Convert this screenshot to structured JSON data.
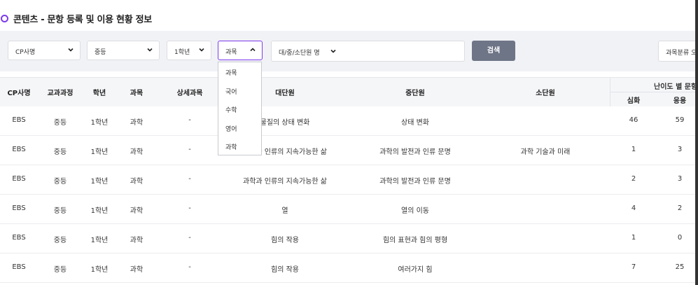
{
  "page": {
    "title": "콘텐츠 - 문항 등록 및 이용 현황 정보"
  },
  "filters": {
    "cp": "CP사명",
    "course": "중등",
    "grade": "1학년",
    "subject": "과목",
    "keyword_placeholder": "대/중/소단원 명",
    "search_label": "검색",
    "category_label": "과목분류 오"
  },
  "subject_options": [
    "과목",
    "국어",
    "수학",
    "영어",
    "과학"
  ],
  "table": {
    "headers": {
      "cp": "CP사명",
      "course": "교과과정",
      "grade": "학년",
      "subject": "과목",
      "detail": "상세과목",
      "large": "대단원",
      "mid": "중단원",
      "small": "소단원",
      "difficulty_group": "난이도 별 문항",
      "deep": "심화",
      "apply": "응용"
    },
    "rows": [
      {
        "cp": "EBS",
        "course": "중등",
        "grade": "1학년",
        "subject": "과학",
        "detail": "-",
        "large": "물질의 상태 변화",
        "mid": "상태 변화",
        "small": "",
        "deep": "46",
        "apply": "59"
      },
      {
        "cp": "EBS",
        "course": "중등",
        "grade": "1학년",
        "subject": "과학",
        "detail": "-",
        "large": "과학과 인류의 지속가능한 삶",
        "mid": "과학의 발전과 인류 문명",
        "small": "과학 기술과 미래",
        "deep": "1",
        "apply": "3"
      },
      {
        "cp": "EBS",
        "course": "중등",
        "grade": "1학년",
        "subject": "과학",
        "detail": "-",
        "large": "과학과 인류의 지속가능한 삶",
        "mid": "과학의 발전과 인류 문명",
        "small": "",
        "deep": "2",
        "apply": "3"
      },
      {
        "cp": "EBS",
        "course": "중등",
        "grade": "1학년",
        "subject": "과학",
        "detail": "-",
        "large": "열",
        "mid": "열의 이동",
        "small": "",
        "deep": "4",
        "apply": "2"
      },
      {
        "cp": "EBS",
        "course": "중등",
        "grade": "1학년",
        "subject": "과학",
        "detail": "-",
        "large": "힘의 작용",
        "mid": "힘의 표현과 힘의 평형",
        "small": "",
        "deep": "1",
        "apply": "0"
      },
      {
        "cp": "EBS",
        "course": "중등",
        "grade": "1학년",
        "subject": "과학",
        "detail": "-",
        "large": "힘의 작용",
        "mid": "여러가지 힘",
        "small": "",
        "deep": "7",
        "apply": "25"
      }
    ]
  },
  "colors": {
    "accent": "#7c3aed",
    "search_button": "#6e7587",
    "panel_bg": "#f1f2f5"
  },
  "icons": {
    "select_arrow": "chevron-down-icon",
    "open_select_arrow": "chevron-up-icon",
    "title_marker": "circle-icon"
  }
}
